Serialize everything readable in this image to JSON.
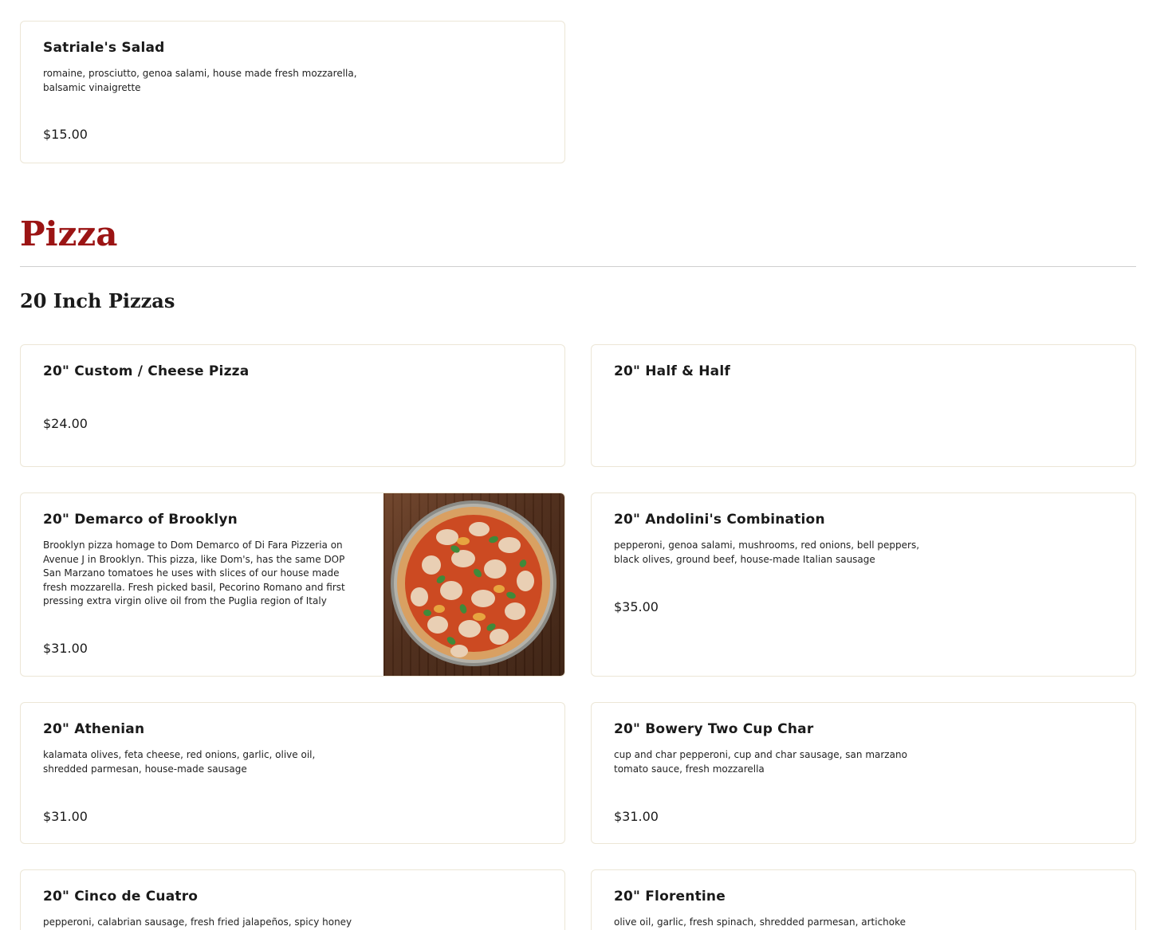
{
  "salad_card": {
    "name": "Satriale's Salad",
    "description": "romaine, prosciutto, genoa salami, house made fresh mozzarella, balsamic vinaigrette",
    "price": "$15.00"
  },
  "section": {
    "title": "Pizza",
    "subsection_title": "20 Inch Pizzas"
  },
  "items": [
    {
      "name": "20\" Custom / Cheese Pizza",
      "description": "",
      "price": "$24.00"
    },
    {
      "name": "20\" Half & Half",
      "description": "",
      "price": ""
    },
    {
      "name": "20\" Demarco of Brooklyn",
      "description": "Brooklyn pizza homage to Dom Demarco of Di Fara Pizzeria on Avenue J in Brooklyn. This pizza, like Dom's, has the same DOP San Marzano tomatoes he uses with slices of our house made fresh mozzarella. Fresh picked basil, Pecorino Romano and first pressing extra virgin olive oil from the Puglia region of Italy",
      "price": "$31.00",
      "image": "pizza-photo"
    },
    {
      "name": "20\" Andolini's Combination",
      "description": "pepperoni, genoa salami, mushrooms, red onions, bell peppers, black olives, ground beef, house-made Italian sausage",
      "price": "$35.00"
    },
    {
      "name": "20\" Athenian",
      "description": "kalamata olives, feta cheese, red onions, garlic, olive oil, shredded parmesan, house-made sausage",
      "price": "$31.00"
    },
    {
      "name": "20\" Bowery Two Cup Char",
      "description": "cup and char pepperoni, cup and char sausage, san marzano tomato sauce, fresh mozzarella",
      "price": "$31.00"
    },
    {
      "name": "20\" Cinco de Cuatro",
      "description": "pepperoni, calabrian sausage, fresh fried jalapeños, spicy honey",
      "price": ""
    },
    {
      "name": "20\" Florentine",
      "description": "olive oil, garlic, fresh spinach, shredded parmesan, artichoke hearts",
      "price": ""
    }
  ],
  "colors": {
    "section_title": "#9b1414",
    "card_border": "#ece6d6",
    "divider": "#cfcfcf"
  }
}
